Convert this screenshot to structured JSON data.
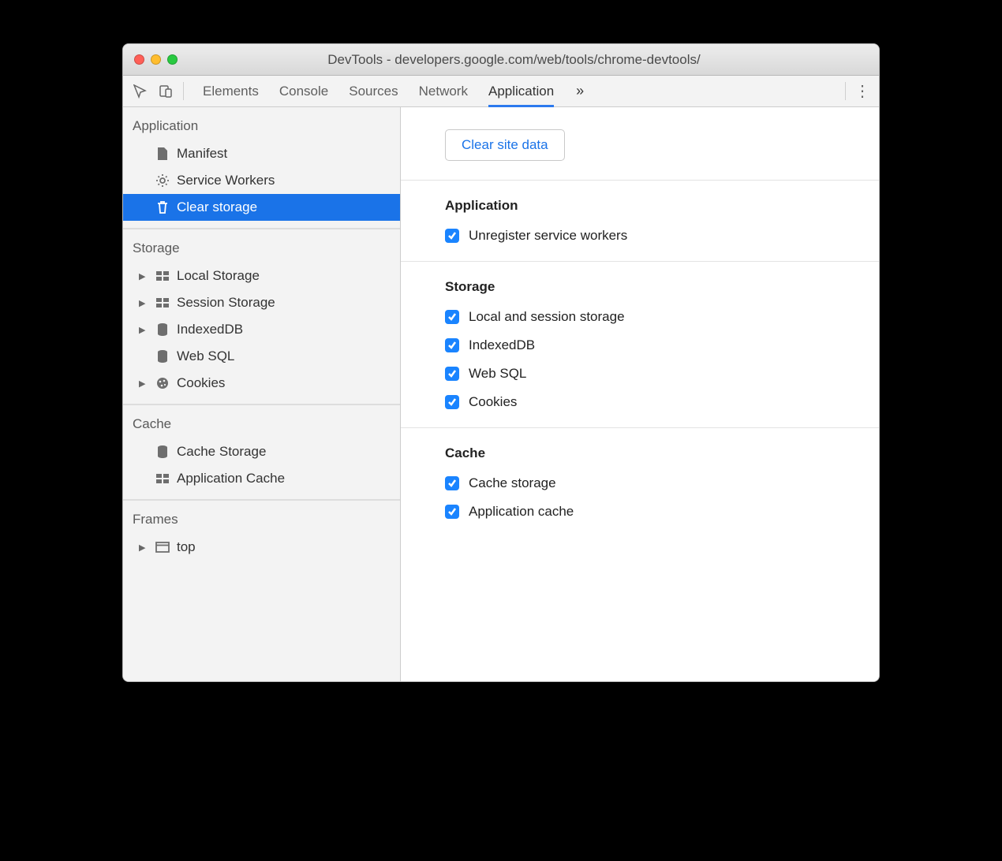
{
  "window": {
    "title": "DevTools - developers.google.com/web/tools/chrome-devtools/",
    "traffic_light_colors": {
      "close": "#ff5f57",
      "minimize": "#ffbd2e",
      "zoom": "#28c940"
    }
  },
  "toolbar": {
    "tabs": [
      "Elements",
      "Console",
      "Sources",
      "Network",
      "Application"
    ],
    "active_tab_index": 4,
    "overflow_glyph": "»",
    "menu_glyph": "⋮"
  },
  "sidebar": {
    "groups": [
      {
        "title": "Application",
        "items": [
          {
            "label": "Manifest",
            "icon": "file-icon",
            "expandable": false,
            "selected": false
          },
          {
            "label": "Service Workers",
            "icon": "gear-icon",
            "expandable": false,
            "selected": false
          },
          {
            "label": "Clear storage",
            "icon": "trash-icon",
            "expandable": false,
            "selected": true
          }
        ]
      },
      {
        "title": "Storage",
        "items": [
          {
            "label": "Local Storage",
            "icon": "grid-icon",
            "expandable": true,
            "selected": false
          },
          {
            "label": "Session Storage",
            "icon": "grid-icon",
            "expandable": true,
            "selected": false
          },
          {
            "label": "IndexedDB",
            "icon": "database-icon",
            "expandable": true,
            "selected": false
          },
          {
            "label": "Web SQL",
            "icon": "database-icon",
            "expandable": false,
            "selected": false
          },
          {
            "label": "Cookies",
            "icon": "cookie-icon",
            "expandable": true,
            "selected": false
          }
        ]
      },
      {
        "title": "Cache",
        "items": [
          {
            "label": "Cache Storage",
            "icon": "database-icon",
            "expandable": false,
            "selected": false
          },
          {
            "label": "Application Cache",
            "icon": "grid-icon",
            "expandable": false,
            "selected": false
          }
        ]
      },
      {
        "title": "Frames",
        "items": [
          {
            "label": "top",
            "icon": "frame-icon",
            "expandable": true,
            "selected": false
          }
        ]
      }
    ]
  },
  "content": {
    "clear_button_label": "Clear site data",
    "sections": [
      {
        "title": "Application",
        "checks": [
          {
            "label": "Unregister service workers",
            "checked": true
          }
        ]
      },
      {
        "title": "Storage",
        "checks": [
          {
            "label": "Local and session storage",
            "checked": true
          },
          {
            "label": "IndexedDB",
            "checked": true
          },
          {
            "label": "Web SQL",
            "checked": true
          },
          {
            "label": "Cookies",
            "checked": true
          }
        ]
      },
      {
        "title": "Cache",
        "checks": [
          {
            "label": "Cache storage",
            "checked": true
          },
          {
            "label": "Application cache",
            "checked": true
          }
        ]
      }
    ]
  },
  "colors": {
    "accent": "#1a73e8",
    "checkbox": "#1a84ff"
  }
}
